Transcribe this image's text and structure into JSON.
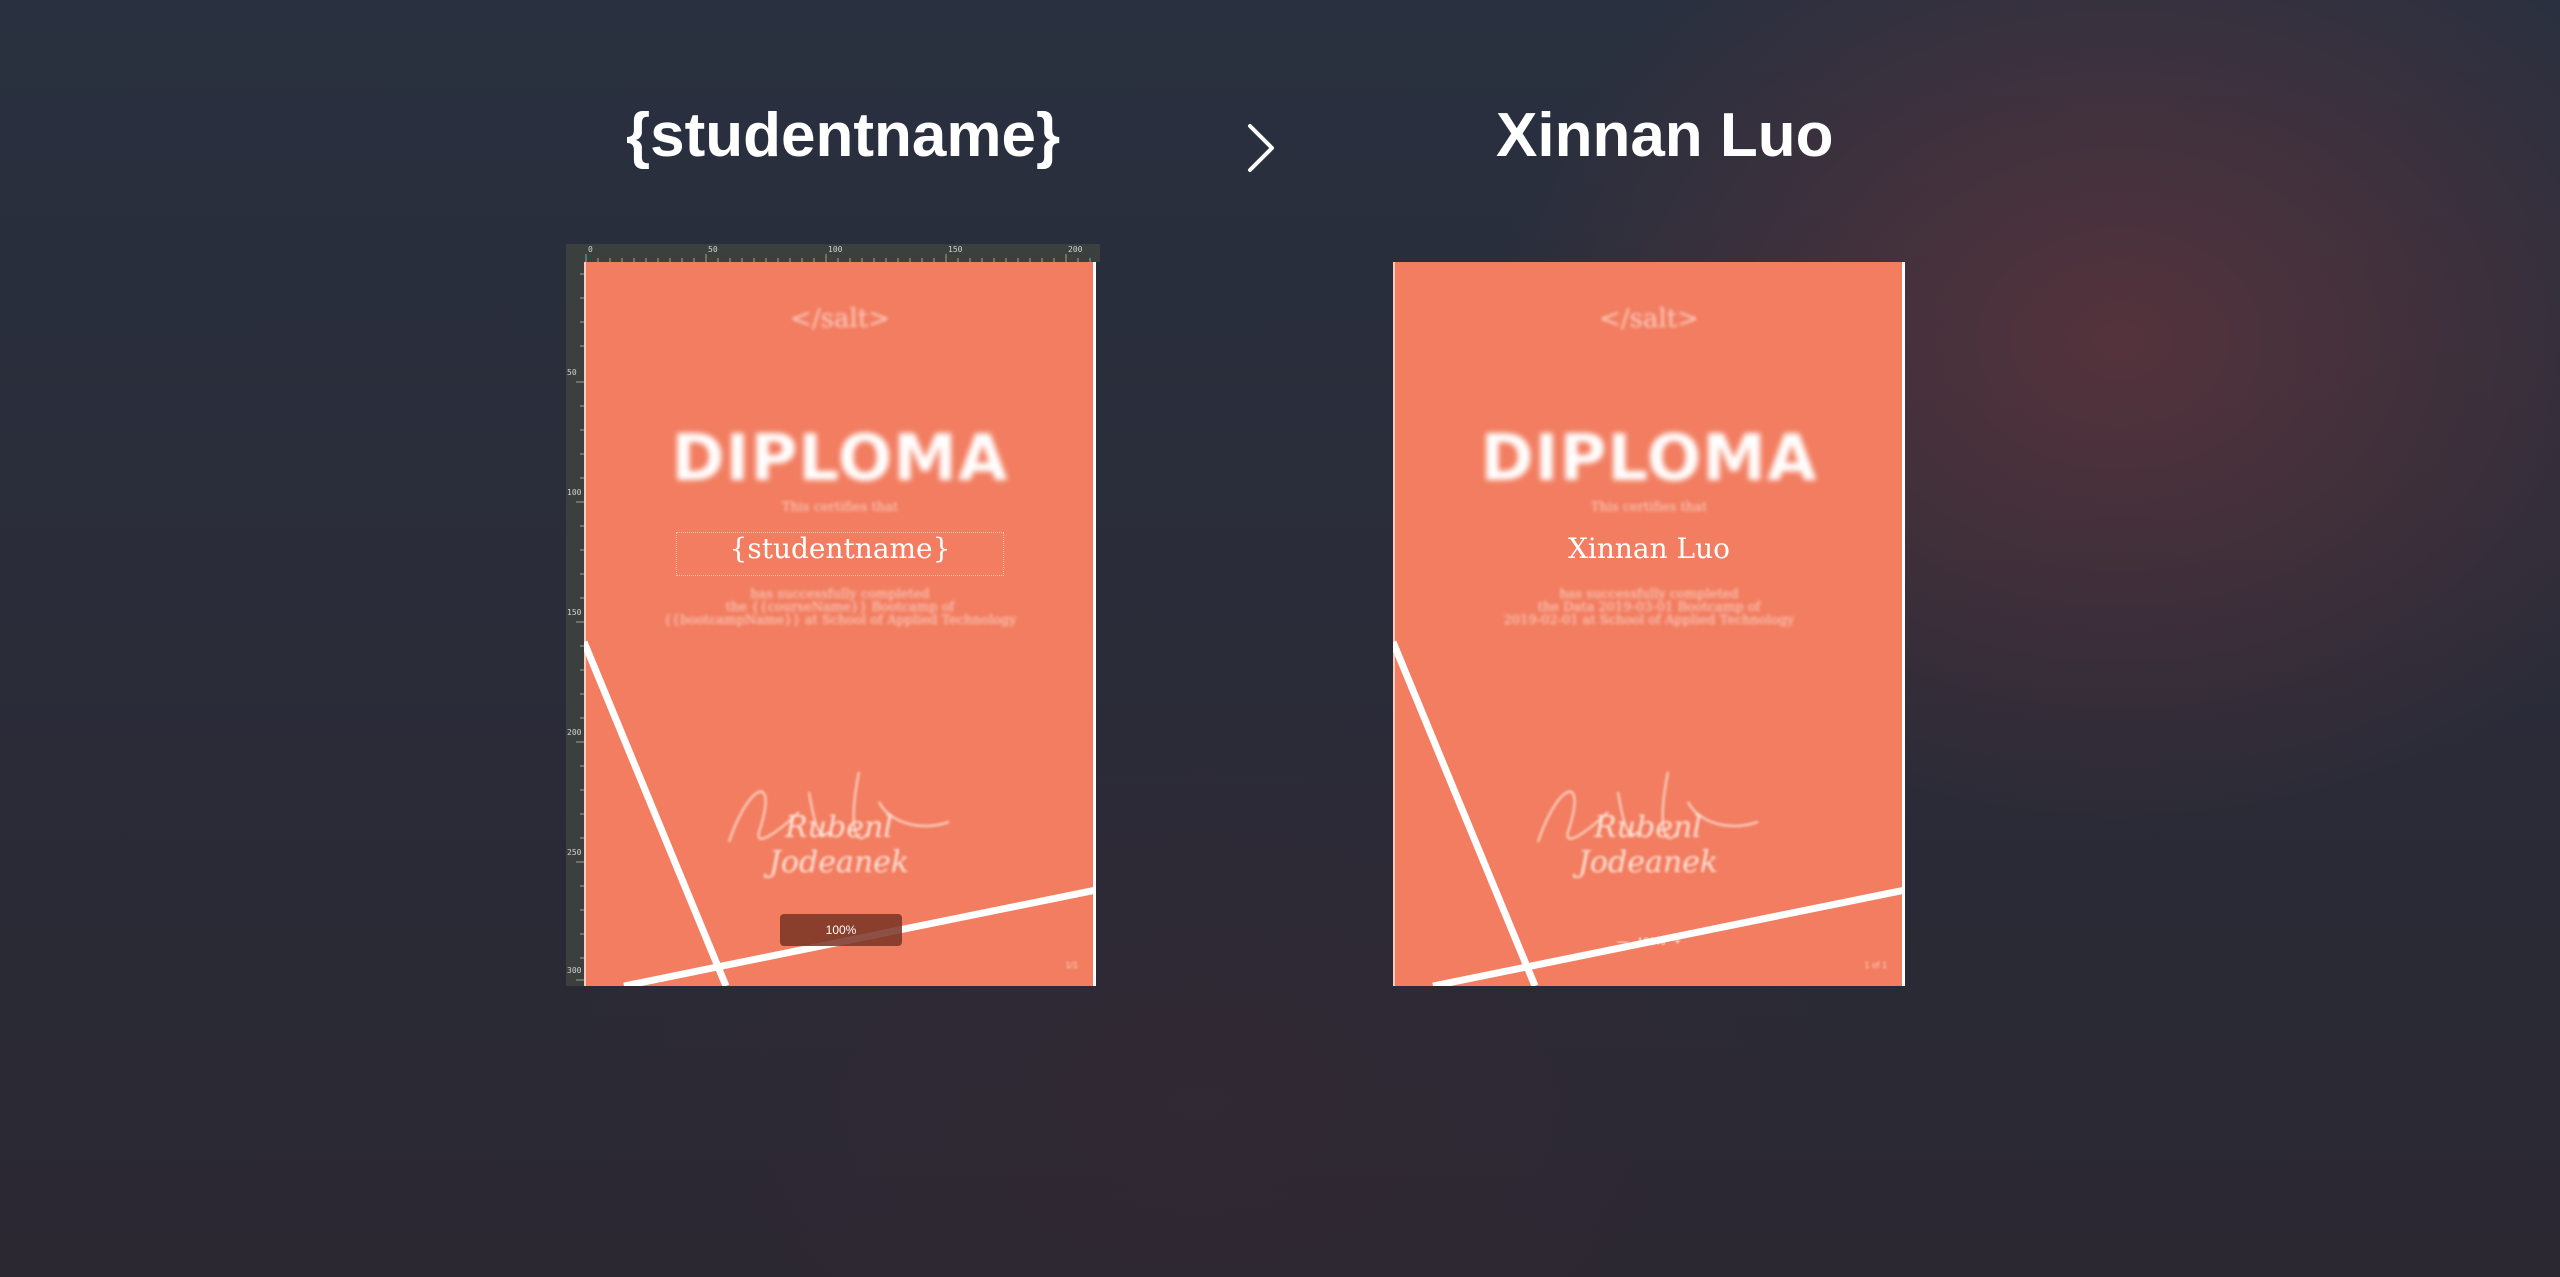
{
  "headings": {
    "left": "{studentname}",
    "right": "Xinnan Luo"
  },
  "arrow_icon": "chevron-right-icon",
  "rulers": {
    "top_labels": [
      "0",
      "50",
      "100",
      "150",
      "200"
    ],
    "left_labels": [
      "50",
      "100",
      "150",
      "200",
      "250",
      "300"
    ]
  },
  "left_diploma": {
    "logo": "</salt>",
    "title": "DIPLOMA",
    "certifies": "This certifies that",
    "student": "{studentname}",
    "body_lines": [
      "has successfully completed",
      "the {{courseName}} Bootcamp of",
      "{{bootcampName}} at School of Applied Technology"
    ],
    "signature": "Rubenl Jodeanek",
    "zoom": "100%",
    "corner": "1/1"
  },
  "right_diploma": {
    "logo": "</salt>",
    "title": "DIPLOMA",
    "certifies": "This certifies that",
    "student": "Xinnan Luo",
    "body_lines": [
      "has successfully completed",
      "the Data 2019-03-01 Bootcamp of",
      "2019-02-01 at School of Applied Technology"
    ],
    "signature": "Rubenl Jodeanek",
    "zoom_minus": "—",
    "zoom": "100%",
    "zoom_plus": "+",
    "corner": "1 of 1"
  },
  "colors": {
    "diploma_bg": "#f27d60",
    "page_bg": "#29303f",
    "text": "#ffffff"
  }
}
